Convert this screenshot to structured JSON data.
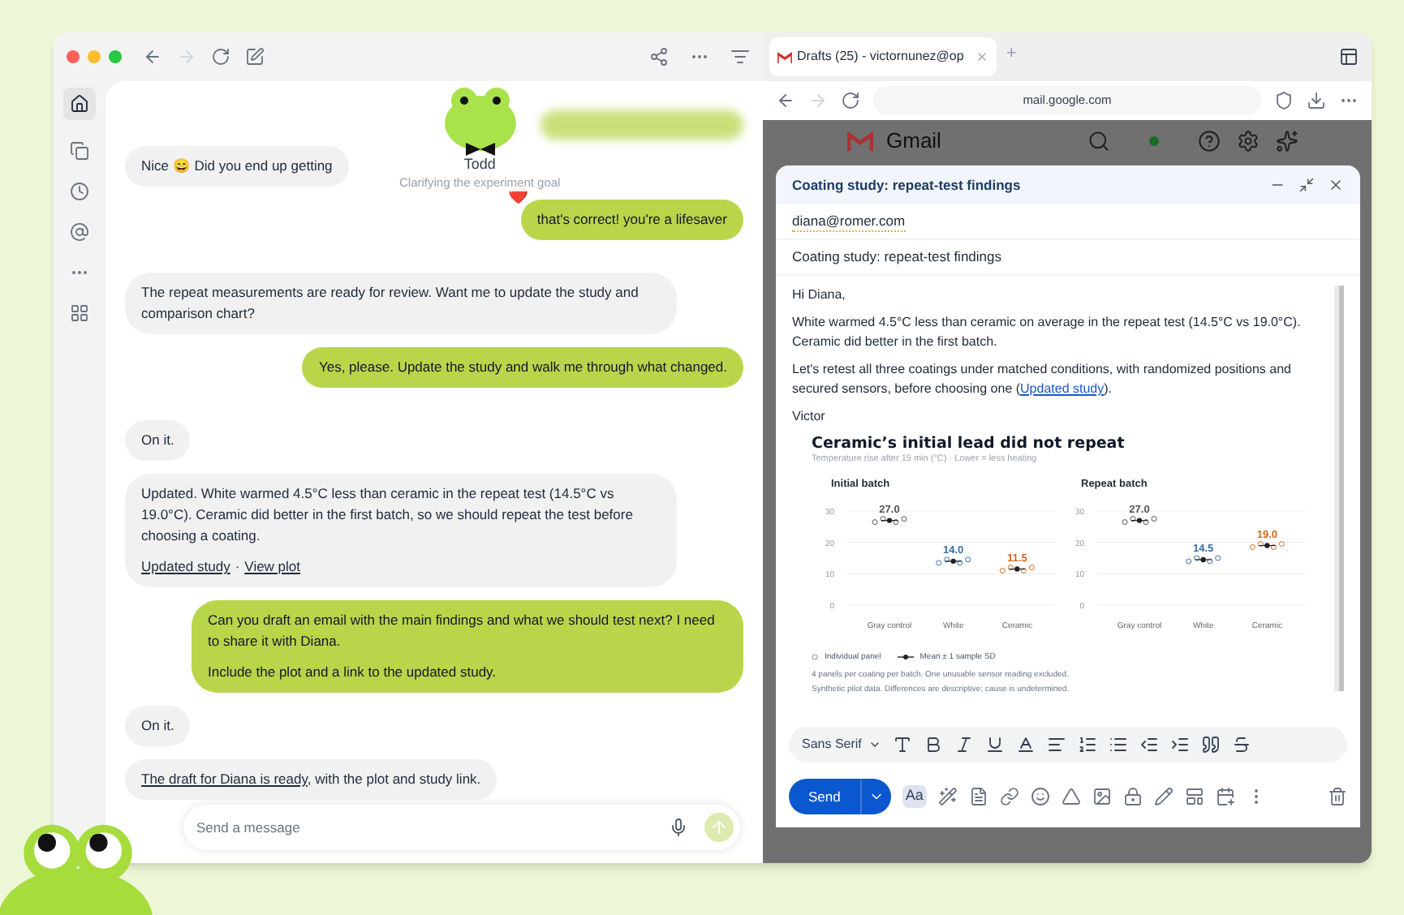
{
  "chat_window": {
    "assistant": {
      "name": "Todd",
      "status": "Clarifying the experiment goal"
    },
    "messages": [
      {
        "kind": "bot",
        "paragraphs": [
          "Nice 😄 Did you end up getting"
        ]
      },
      {
        "kind": "user",
        "reaction": "❤️",
        "paragraphs": [
          "that's correct! you're a lifesaver"
        ]
      },
      {
        "kind": "bot",
        "paragraphs": [
          "The repeat measurements are ready for review. Want me to update the study and comparison chart?"
        ]
      },
      {
        "kind": "user",
        "paragraphs": [
          "Yes, please. Update the study and walk me through what changed."
        ]
      },
      {
        "kind": "bot",
        "paragraphs": [
          "On it."
        ]
      },
      {
        "kind": "bot",
        "paragraphs": [
          "Updated. White warmed 4.5°C less than ceramic in the repeat test (14.5°C vs 19.0°C). Ceramic did better in the first batch, so we should repeat the test before choosing a coating."
        ],
        "links": [
          "Updated study",
          "View plot"
        ],
        "link_separator": "·"
      },
      {
        "kind": "user",
        "paragraphs": [
          "Can you draft an email with the main findings and what we should test next? I need to share it with Diana.",
          "Include the plot and a link to the updated study."
        ]
      },
      {
        "kind": "bot",
        "paragraphs": [
          "On it."
        ]
      },
      {
        "kind": "bot",
        "parts": [
          {
            "text": "The draft for Diana is ready",
            "link": true
          },
          {
            "text": ", with the plot and study link.",
            "link": false
          }
        ]
      }
    ],
    "input": {
      "placeholder": "Send a message"
    }
  },
  "browser": {
    "tabs": [
      {
        "label": "Drafts (25) - victornunez@op",
        "selected": true
      }
    ],
    "new_tab": "+",
    "address": "mail.google.com",
    "app_name": "Gmail",
    "compose": {
      "title": "Coating study: repeat-test findings",
      "to": "diana@romer.com",
      "subject": "Coating study: repeat-test findings",
      "body": [
        "Hi Diana,",
        "White warmed 4.5°C less than ceramic on average in the repeat test (14.5°C vs 19.0°C). Ceramic did better in the first batch."
      ],
      "closing_sentence": {
        "text": "Let's retest all three coatings under matched conditions, with randomized positions and secured sensors, before choosing one (",
        "link": "Updated study",
        "after": ")."
      },
      "signature": "Victor",
      "figure": {
        "title": "Ceramic’s initial lead did not repeat",
        "subtitle": "Temperature rise after 15 min (°C) · Lower = less heating",
        "panels": [
          {
            "chart_data": {
              "type": "scatter",
              "title": "Initial batch",
              "categories": [
                "Gray control",
                "White",
                "Ceramic"
              ],
              "series": [
                {
                  "color": "#555555",
                  "values": [
                    27.0,
                    null,
                    null
                  ],
                  "value_labels": [
                    "27.0",
                    null,
                    null
                  ]
                },
                {
                  "color": "#3a6ea5",
                  "values": [
                    null,
                    14.0,
                    null
                  ],
                  "value_labels": [
                    null,
                    "14.0",
                    null
                  ]
                },
                {
                  "color": "#d2691e",
                  "values": [
                    null,
                    null,
                    11.5
                  ],
                  "value_labels": [
                    null,
                    null,
                    "11.5"
                  ]
                }
              ],
              "ylim": [
                0,
                30
              ],
              "yticks": [
                0,
                10,
                20,
                30
              ]
            }
          },
          {
            "chart_data": {
              "type": "scatter",
              "title": "Repeat batch",
              "categories": [
                "Gray control",
                "White",
                "Ceramic"
              ],
              "series": [
                {
                  "color": "#555555",
                  "values": [
                    27.0,
                    null,
                    null
                  ],
                  "value_labels": [
                    "27.0",
                    null,
                    null
                  ]
                },
                {
                  "color": "#3a6ea5",
                  "values": [
                    null,
                    14.5,
                    null
                  ],
                  "value_labels": [
                    null,
                    "14.5",
                    null
                  ]
                },
                {
                  "color": "#d2691e",
                  "values": [
                    null,
                    null,
                    19.0
                  ],
                  "value_labels": [
                    null,
                    null,
                    "19.0"
                  ]
                }
              ],
              "ylim": [
                0,
                30
              ],
              "yticks": [
                0,
                10,
                20,
                30
              ]
            }
          }
        ],
        "legend": [
          {
            "kind": "circle",
            "label": "Individual panel"
          },
          {
            "kind": "mean",
            "label": "Mean ± 1 sample SD"
          }
        ],
        "notes": [
          "4 panels per coating per batch. One unusable sensor reading excluded.",
          "Synthetic pilot data. Differences are descriptive; cause is undetermined."
        ]
      },
      "font": "Sans Serif",
      "send": "Send",
      "text_style": "Aa"
    }
  }
}
